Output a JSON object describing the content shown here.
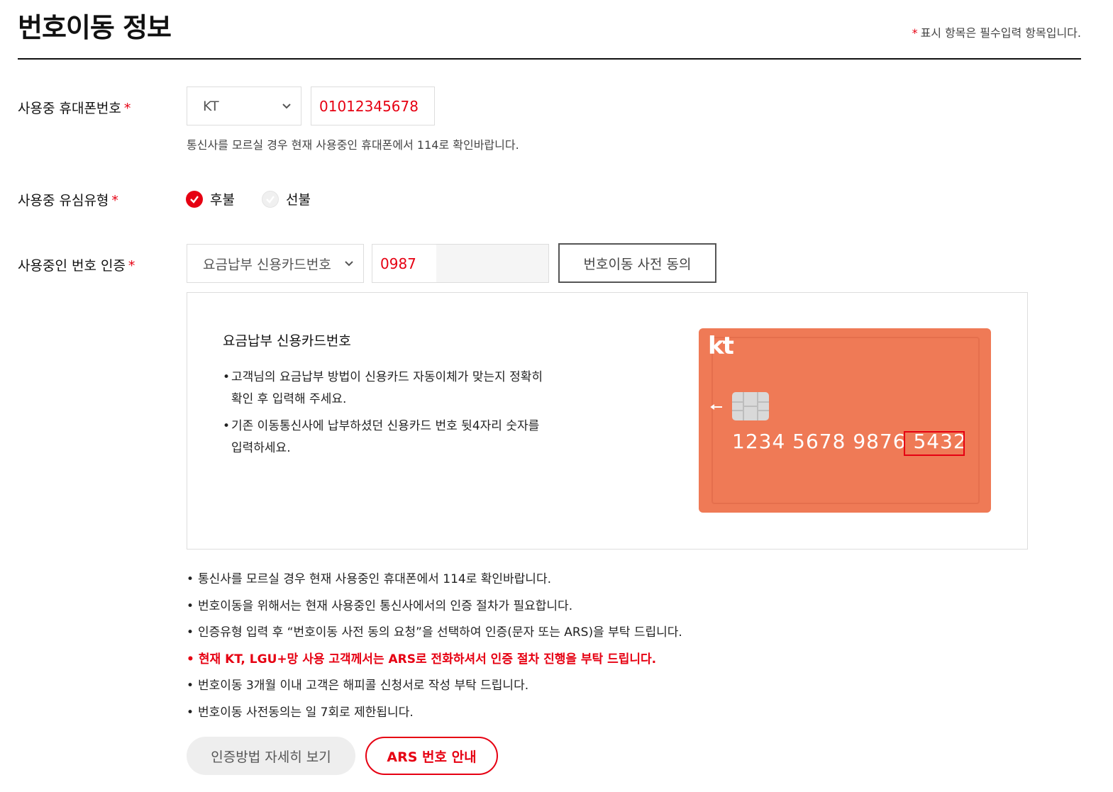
{
  "page": {
    "title": "번호이동 정보",
    "required_star": "*",
    "required_note": "표시 항목은 필수입력 항목입니다."
  },
  "phone": {
    "label": "사용중 휴대폰번호",
    "star": "*",
    "carrier_selected": "KT",
    "number_value": "01012345678",
    "help": "통신사를 모르실 경우 현재 사용중인 휴대폰에서 114로 확인바랍니다."
  },
  "sim": {
    "label": "사용중 유심유형",
    "star": "*",
    "options": [
      {
        "label": "후불",
        "checked": true
      },
      {
        "label": "선불",
        "checked": false
      }
    ]
  },
  "auth": {
    "label": "사용중인 번호 인증",
    "star": "*",
    "method_selected": "요금납부 신용카드번호",
    "input_value": "0987",
    "consent_button": "번호이동 사전 동의"
  },
  "panel": {
    "title": "요금납부 신용카드번호",
    "bullets": [
      {
        "line1": "고객님의 요금납부 방법이 신용카드 자동이체가 맞는지 정확히",
        "line2": "확인 후 입력해 주세요."
      },
      {
        "line1": "기존 이동통신사에 납부하셨던 신용카드 번호 뒷4자리 숫자를",
        "line2": "입력하세요."
      }
    ],
    "card": {
      "logo": "kt",
      "number_prefix": "1234 5678 9876",
      "number_last4": "5432",
      "color": "#ef7a56",
      "highlight_color": "#e60012"
    }
  },
  "notes": [
    {
      "text": "통신사를 모르실 경우 현재 사용중인 휴대폰에서 114로 확인바랍니다.",
      "emphasis": false
    },
    {
      "text": "번호이동을 위해서는 현재 사용중인 통신사에서의 인증 절차가 필요합니다.",
      "emphasis": false
    },
    {
      "text": "인증유형 입력 후 “번호이동 사전 동의 요청”을 선택하여 인증(문자 또는 ARS)을 부탁 드립니다.",
      "emphasis": false
    },
    {
      "text": "현재 KT, LGU+망 사용 고객께서는 ARS로 전화하셔서 인증 절차 진행을 부탁 드립니다.",
      "emphasis": true
    },
    {
      "text": "번호이동 3개월 이내 고객은 해피콜 신청서로 작성 부탁 드립니다.",
      "emphasis": false
    },
    {
      "text": "번호이동 사전동의는 일 7회로 제한됩니다.",
      "emphasis": false
    }
  ],
  "bullet_char": "•",
  "buttons": {
    "auth_detail": "인증방법 자세히 보기",
    "ars_info": "ARS 번호 안내"
  },
  "colors": {
    "accent": "#e60012",
    "border": "#dddddd"
  },
  "icons": {
    "select_arrow": "chevron-down-icon",
    "radio_checked": "check-circle-icon",
    "radio_unchecked": "check-circle-outline-icon",
    "card_chip": "chip-icon"
  }
}
